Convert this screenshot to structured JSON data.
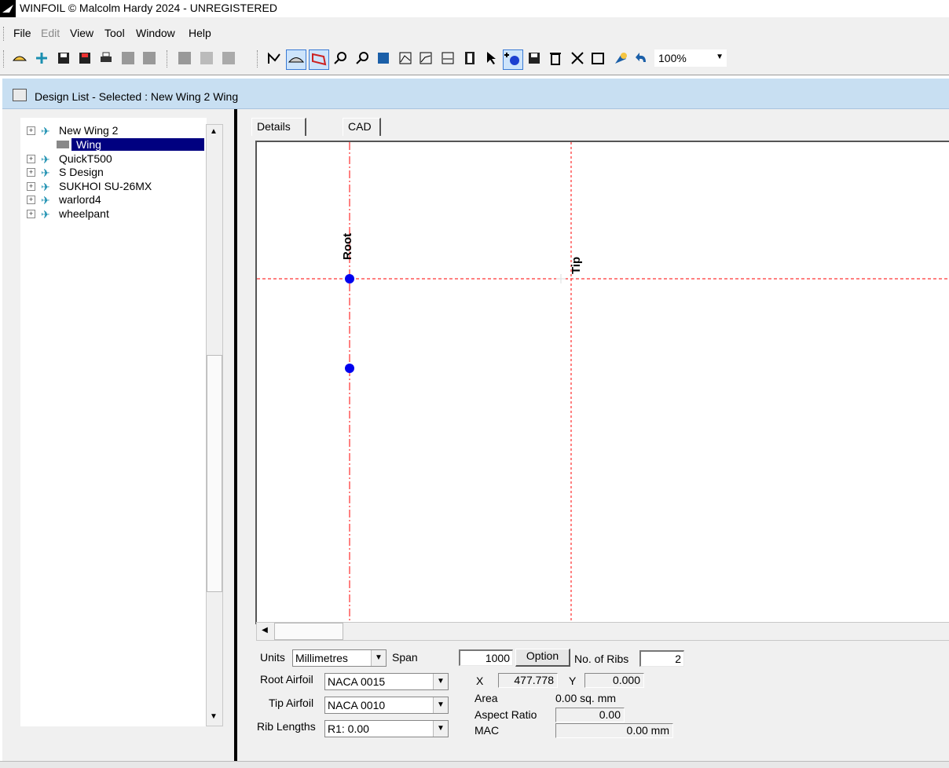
{
  "window": {
    "title": "WINFOIL © Malcolm Hardy 2024 - UNREGISTERED"
  },
  "menu": {
    "file": "File",
    "edit": "Edit",
    "view": "View",
    "tool": "Tool",
    "window": "Window",
    "help": "Help"
  },
  "toolbar": {
    "zoom": "100%"
  },
  "child_window": {
    "title": "Design List - Selected : New Wing 2 Wing"
  },
  "tree": {
    "items": [
      {
        "label": "New Wing 2"
      },
      {
        "label": "Wing"
      },
      {
        "label": "QuickT500"
      },
      {
        "label": "S Design"
      },
      {
        "label": "SUKHOI SU-26MX"
      },
      {
        "label": "warlord4"
      },
      {
        "label": "wheelpant"
      }
    ]
  },
  "tabs": [
    {
      "label": "Details"
    },
    {
      "label": "CAD"
    }
  ],
  "canvas": {
    "root_label": "Root",
    "tip_label": "Tip"
  },
  "form": {
    "units_label": "Units",
    "units_value": "Millimetres",
    "span_label": "Span",
    "span_value": "1000",
    "option_button": "Option",
    "ribs_label": "No. of Ribs",
    "ribs_value": "2",
    "root_airfoil_label": "Root Airfoil",
    "root_airfoil_value": "NACA 0015",
    "tip_airfoil_label": "Tip Airfoil",
    "tip_airfoil_value": "NACA 0010",
    "rib_lengths_label": "Rib Lengths",
    "rib_lengths_value": "R1: 0.00",
    "x_label": "X",
    "x_value": "477.778",
    "y_label": "Y",
    "y_value": "0.000",
    "area_label": "Area",
    "area_value": "0.00 sq. mm",
    "aspect_label": "Aspect Ratio",
    "aspect_value": "0.00",
    "mac_label": "MAC",
    "mac_value": "0.00 mm"
  },
  "colors": {
    "selection": "#000080",
    "guide_line": "#ff0000",
    "point": "#0000ee",
    "titlebar_active": "#c8dff2"
  }
}
